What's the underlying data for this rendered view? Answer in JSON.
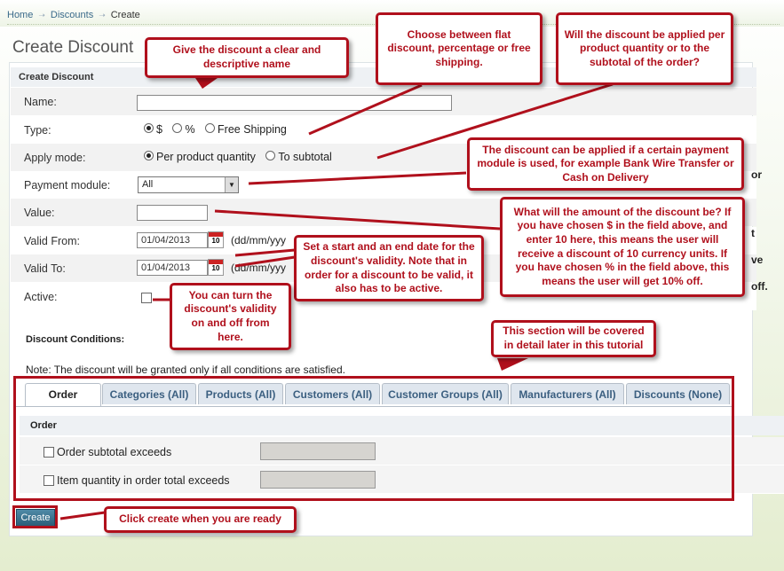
{
  "breadcrumb": {
    "items": [
      "Home",
      "Discounts",
      "Create"
    ]
  },
  "page_title": "Create Discount",
  "panel_title": "Create Discount",
  "form": {
    "name": {
      "label": "Name:",
      "value": ""
    },
    "type": {
      "label": "Type:",
      "options": [
        "$",
        "%",
        "Free Shipping"
      ],
      "selected": "$"
    },
    "apply_mode": {
      "label": "Apply mode:",
      "options": [
        "Per product quantity",
        "To subtotal"
      ],
      "selected": "Per product quantity"
    },
    "payment_module": {
      "label": "Payment module:",
      "value": "All"
    },
    "value": {
      "label": "Value:",
      "value": ""
    },
    "valid_from": {
      "label": "Valid From:",
      "value": "01/04/2013",
      "hint": "(dd/mm/yyy",
      "cal_day": "10"
    },
    "valid_to": {
      "label": "Valid To:",
      "value": "01/04/2013",
      "hint": "(dd/mm/yyy",
      "cal_day": "10"
    },
    "active": {
      "label": "Active:",
      "checked": false
    }
  },
  "conditions": {
    "label": "Discount Conditions:",
    "note": "Note: The discount will be granted only if all conditions are satisfied.",
    "tabs": [
      "Order",
      "Categories (All)",
      "Products (All)",
      "Customers (All)",
      "Customer Groups (All)",
      "Manufacturers (All)",
      "Discounts (None)"
    ],
    "active_tab": "Order",
    "section_title": "Order",
    "rows": [
      {
        "label": "Order subtotal exceeds",
        "checked": false
      },
      {
        "label": "Item quantity in order total exceeds",
        "checked": false
      }
    ]
  },
  "create_button": "Create",
  "callouts": {
    "name": "Give the discount a clear and descriptive name",
    "type": "Choose between flat discount, percentage or free shipping.",
    "apply": "Will the discount be applied per product quantity or to the subtotal of the order?",
    "payment": "The discount can be applied if a certain payment module is used, for example Bank Wire Transfer or Cash on Delivery",
    "value": "What will the amount of the discount be? If you have chosen $ in the field above, and enter 10 here, this means the user will receive a discount of 10 currency units. If you have chosen % in the field above, this means the user will get 10% off.",
    "dates": "Set a start and an end date for the discount's validity. Note that in order for a discount to be valid, it also has to be active.",
    "active": "You can turn the discount's validity on and off from here.",
    "section": "This section will be covered in detail later in this tutorial",
    "create": "Click create when you are ready"
  },
  "partial_hidden_text": [
    "or",
    "t",
    "ve",
    "off."
  ],
  "colors": {
    "callout_red": "#b0101c",
    "link_blue": "#3a6a8a",
    "button_teal": "#2a5d78"
  }
}
